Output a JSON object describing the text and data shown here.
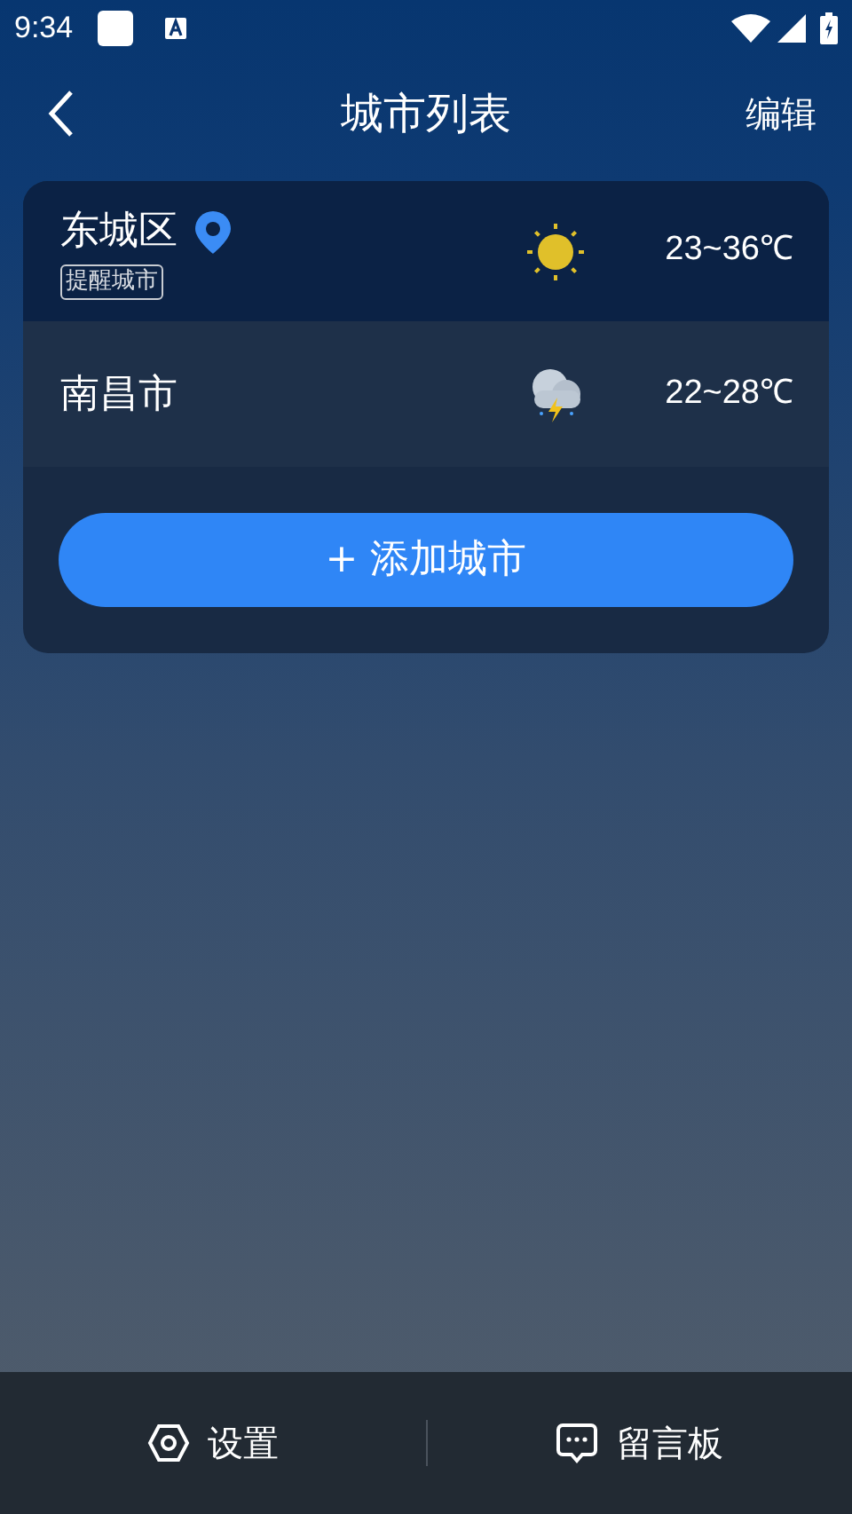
{
  "status_bar": {
    "time": "9:34"
  },
  "header": {
    "title": "城市列表",
    "action": "编辑"
  },
  "cities": [
    {
      "name": "东城区",
      "located": true,
      "tag": "提醒城市",
      "kind": "sunny",
      "temp": "23~36℃"
    },
    {
      "name": "南昌市",
      "located": false,
      "kind": "thunderstorm",
      "temp": "22~28℃"
    }
  ],
  "add_button": "+ 添加城市",
  "bottom_bar": [
    {
      "kind": "settings",
      "label": "设置"
    },
    {
      "kind": "message",
      "label": "留言板"
    }
  ]
}
